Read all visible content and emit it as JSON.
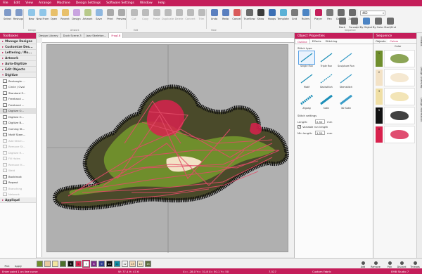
{
  "menu": [
    "File",
    "Edit",
    "View",
    "Arrange",
    "Machine",
    "Design Settings",
    "Software Settings",
    "Window",
    "Help"
  ],
  "ribbon": {
    "buttons": [
      "Select",
      "Reshape",
      "New",
      "New From",
      "Open",
      "Recent",
      "Design",
      "Artwork",
      "Save",
      "Print",
      "Preview",
      "Cut",
      "Copy",
      "Paste",
      "Duplicate",
      "Delete",
      "Convert",
      "Trim",
      "Undo",
      "Redo",
      "Cancel",
      "TrueView",
      "Show",
      "Hoops",
      "Template",
      "Grid",
      "Rulers",
      "Player",
      "Pan",
      "Design",
      "Zoom",
      "Back",
      "Forward",
      "By Object",
      "By Color",
      "Start/End"
    ],
    "zoom_value": "462",
    "groups": [
      "Design",
      "Artwork",
      "Edit",
      "View",
      "Sequence"
    ]
  },
  "toolbox": {
    "title": "Toolboxes",
    "sections": [
      {
        "label": "Manage Designs"
      },
      {
        "label": "Customize Des..."
      },
      {
        "label": "Lettering / Mo..."
      },
      {
        "label": "Artwork"
      },
      {
        "label": "Auto-Digitize"
      },
      {
        "label": "Edit Objects"
      },
      {
        "label": "Digitize"
      }
    ],
    "digitize_items": [
      "Rectangle ...",
      "Circle / Oval",
      "Standard S...",
      "Freehand ...",
      "Freehand ...",
      "Digitize O...",
      "Digitize O...",
      "Digitize B...",
      "Coming St...",
      "Motif Stam...",
      "Add Stitch...",
      "Remove St...",
      "Digitize H...",
      "Fill Holes",
      "Remove H...",
      "Weld",
      "Backtrack",
      "Repeat",
      "Branching",
      "Network"
    ],
    "bottom_section": "Appliqué"
  },
  "doc_tabs": [
    "Design Library",
    "Duck Scene.3",
    "Jazz Skeleton...",
    "Frog18"
  ],
  "properties": {
    "title": "Object Properties",
    "tabs": [
      "Outline",
      "Effects",
      "Stitching"
    ],
    "section_stitch_type": "Stitch type",
    "stitch_types": [
      "Single Run",
      "Triple Run",
      "Sculpture Run",
      "Motif",
      "Backstitch",
      "Stemstitch",
      "Zigzag",
      "Satin",
      "3D Satin"
    ],
    "section_settings": "Stitch settings",
    "length_label": "Length:",
    "length_value": "2.50",
    "length_unit": "mm",
    "variable_label": "Variable run length",
    "min_length_label": "Min length:",
    "min_length_value": "1.20",
    "min_length_unit": "mm"
  },
  "sequence": {
    "title": "Sequence",
    "tabs": [
      "Objects",
      "Colors"
    ],
    "col_header": "Color",
    "rows": [
      {
        "num": "1",
        "color": "#6f8e2c"
      },
      {
        "num": "2",
        "color": "#f3e2c6"
      },
      {
        "num": "3",
        "color": "#f0dfa5"
      },
      {
        "num": "5",
        "color": "#111111"
      },
      {
        "num": "6",
        "color": "#d8224d"
      }
    ]
  },
  "side_tabs": [
    "Threads",
    "Design Overview",
    "Design Information"
  ],
  "palette": {
    "chips": [
      {
        "label": "",
        "color": "#6f8e2c"
      },
      {
        "label": "",
        "color": "#e8c9a0"
      },
      {
        "label": "",
        "color": "#f2e6a0"
      },
      {
        "label": "",
        "color": "#4a6e2a"
      },
      {
        "label": "5",
        "color": "#111111"
      },
      {
        "label": "6",
        "color": "#d8224d"
      },
      {
        "label": "7",
        "color": "#ffffff"
      },
      {
        "label": "8",
        "color": "#7a2a88"
      },
      {
        "label": "9",
        "color": "#2d3b8f"
      },
      {
        "label": "10",
        "color": "#0c0c0c"
      },
      {
        "label": "11",
        "color": "#0e8ea8"
      },
      {
        "label": "12",
        "color": "#f5f5f5"
      },
      {
        "label": "13",
        "color": "#f3d9b5"
      },
      {
        "label": "14",
        "color": "#f1e6c8"
      },
      {
        "label": "15",
        "color": "#5a6b3a"
      }
    ],
    "actions": [
      "Add",
      "Remove",
      "Pick",
      "Discard",
      "Threads"
    ],
    "left_actions": [
      "Pick",
      "Apply"
    ]
  },
  "status": {
    "hint": "Enter point 1 on line curve",
    "width": "W: 77.4 H: 47.6",
    "coords": "X=: -28.0 Y=: 31.8 X= 50.1 Y= 50",
    "stitches": "7,527",
    "machine": "Custom Fabric",
    "product": "EMB Studio 7"
  },
  "colors": {
    "brand": "#c41e5a"
  }
}
